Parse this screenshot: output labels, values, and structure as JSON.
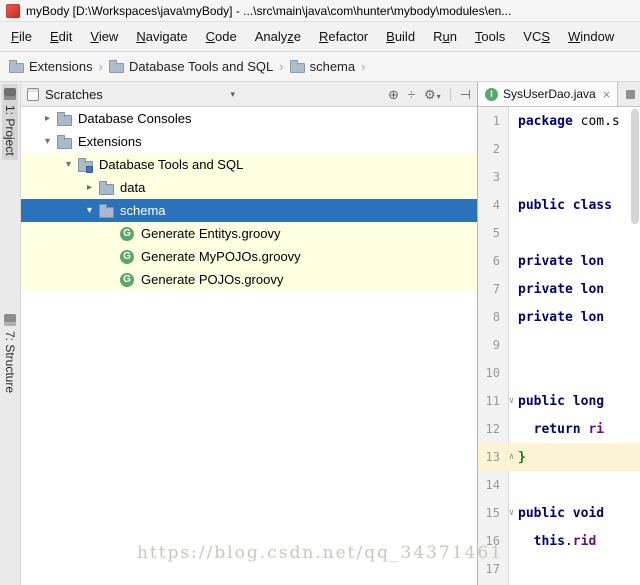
{
  "titlebar": {
    "title": "myBody [D:\\Workspaces\\java\\myBody] - ...\\src\\main\\java\\com\\hunter\\mybody\\modules\\en..."
  },
  "menubar": {
    "items": [
      {
        "label": "File",
        "u": 0
      },
      {
        "label": "Edit",
        "u": 0
      },
      {
        "label": "View",
        "u": 0
      },
      {
        "label": "Navigate",
        "u": 0
      },
      {
        "label": "Code",
        "u": 0
      },
      {
        "label": "Analyze",
        "u": 5
      },
      {
        "label": "Refactor",
        "u": 0
      },
      {
        "label": "Build",
        "u": 0
      },
      {
        "label": "Run",
        "u": 1
      },
      {
        "label": "Tools",
        "u": 0
      },
      {
        "label": "VCS",
        "u": 2
      },
      {
        "label": "Window",
        "u": 0
      }
    ]
  },
  "breadcrumbs": {
    "separator": "›",
    "items": [
      {
        "label": "Extensions"
      },
      {
        "label": "Database Tools and SQL"
      },
      {
        "label": "schema"
      }
    ]
  },
  "tool_stripe": {
    "tabs": [
      {
        "label": "1: Project",
        "active": true
      },
      {
        "label": "7: Structure",
        "active": false
      }
    ]
  },
  "project_pane": {
    "header": {
      "title": "Scratches",
      "caret": "▾",
      "icons": [
        {
          "name": "locate-icon",
          "glyph": "⊕"
        },
        {
          "name": "collapse-all-icon",
          "glyph": "÷"
        },
        {
          "name": "settings-gear-icon",
          "glyph": "⚙"
        },
        {
          "name": "settings-caret-icon",
          "glyph": "▾"
        },
        {
          "name": "hide-panel-icon",
          "glyph": "⊣"
        }
      ]
    },
    "tree": [
      {
        "label": "Database Consoles",
        "level": 0,
        "chevron": "▸",
        "icon": "folder",
        "bg": "none"
      },
      {
        "label": "Extensions",
        "level": 0,
        "chevron": "▾",
        "icon": "folder",
        "bg": "none"
      },
      {
        "label": "Database Tools and SQL",
        "level": 1,
        "chevron": "▾",
        "icon": "plugin",
        "bg": "scratch"
      },
      {
        "label": "data",
        "level": 2,
        "chevron": "▸",
        "icon": "folder",
        "bg": "scratch"
      },
      {
        "label": "schema",
        "level": 2,
        "chevron": "▾",
        "icon": "folder",
        "bg": "selected"
      },
      {
        "label": "Generate Entitys.groovy",
        "level": 3,
        "chevron": "",
        "icon": "groovy",
        "bg": "scratch"
      },
      {
        "label": "Generate MyPOJOs.groovy",
        "level": 3,
        "chevron": "",
        "icon": "groovy",
        "bg": "scratch"
      },
      {
        "label": "Generate POJOs.groovy",
        "level": 3,
        "chevron": "",
        "icon": "groovy",
        "bg": "scratch"
      }
    ]
  },
  "editor": {
    "tab": {
      "icon_letter": "I",
      "label": "SysUserDao.java",
      "close": "×"
    },
    "fold_glyphs": {
      "start": "∨",
      "end": "∧"
    },
    "lines": [
      {
        "n": 1,
        "segs": [
          {
            "t": "package ",
            "c": "kw"
          },
          {
            "t": "com.s",
            "c": "pl"
          }
        ]
      },
      {
        "n": 2,
        "segs": []
      },
      {
        "n": 3,
        "segs": []
      },
      {
        "n": 4,
        "segs": [
          {
            "t": "public class ",
            "c": "kw"
          }
        ]
      },
      {
        "n": 5,
        "segs": []
      },
      {
        "n": 6,
        "segs": [
          {
            "t": "private lon",
            "c": "kw"
          }
        ]
      },
      {
        "n": 7,
        "segs": [
          {
            "t": "private lon",
            "c": "kw"
          }
        ]
      },
      {
        "n": 8,
        "segs": [
          {
            "t": "private lon",
            "c": "kw"
          }
        ]
      },
      {
        "n": 9,
        "segs": []
      },
      {
        "n": 10,
        "segs": []
      },
      {
        "n": 11,
        "segs": [
          {
            "t": "public long",
            "c": "kw"
          }
        ],
        "fold": "start"
      },
      {
        "n": 12,
        "segs": [
          {
            "t": "  ",
            "c": "pl"
          },
          {
            "t": "return ",
            "c": "kw"
          },
          {
            "t": "ri",
            "c": "field"
          }
        ]
      },
      {
        "n": 13,
        "segs": [
          {
            "t": "}",
            "c": "brace"
          }
        ],
        "fold": "end",
        "current": true
      },
      {
        "n": 14,
        "segs": []
      },
      {
        "n": 15,
        "segs": [
          {
            "t": "public void",
            "c": "kw"
          }
        ],
        "fold": "start"
      },
      {
        "n": 16,
        "segs": [
          {
            "t": "  ",
            "c": "pl"
          },
          {
            "t": "this",
            "c": "kw"
          },
          {
            "t": ".",
            "c": "pl"
          },
          {
            "t": "rid",
            "c": "field"
          }
        ]
      },
      {
        "n": 17,
        "segs": []
      }
    ]
  },
  "icons": {
    "groovy_letter": "G"
  },
  "watermark": {
    "text": "https://blog.csdn.net/qq_34371461"
  },
  "colors": {
    "selection_blue": "#2B72BD",
    "scratch_yellow": "#FFFFE1",
    "keyword_navy": "#000080",
    "field_purple": "#660E7A",
    "groovy_green": "#59A869",
    "brace_green": "#0B7A0B"
  }
}
